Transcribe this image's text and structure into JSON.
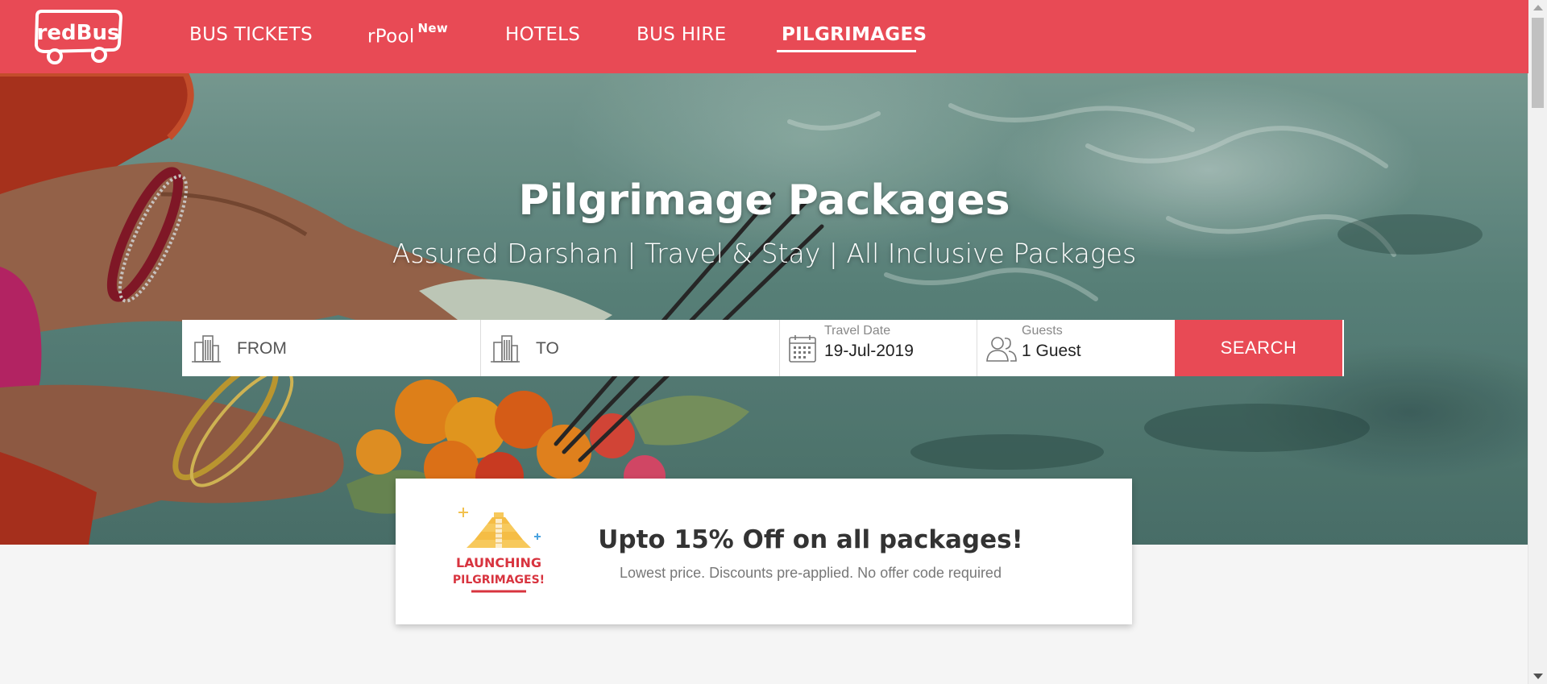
{
  "header": {
    "logo_text": "redBus",
    "nav": [
      {
        "label": "BUS TICKETS",
        "sup": ""
      },
      {
        "label": "rPool",
        "sup": "New"
      },
      {
        "label": "HOTELS",
        "sup": ""
      },
      {
        "label": "BUS HIRE",
        "sup": ""
      },
      {
        "label": "PILGRIMAGES",
        "sup": "",
        "active": true
      }
    ]
  },
  "hero": {
    "title": "Pilgrimage Packages",
    "subtitle": "Assured Darshan | Travel & Stay | All Inclusive Packages"
  },
  "search": {
    "from_placeholder": "FROM",
    "to_placeholder": "TO",
    "date_label": "Travel Date",
    "date_value": "19-Jul-2019",
    "guests_label": "Guests",
    "guests_value": "1 Guest",
    "button_label": "SEARCH"
  },
  "offer": {
    "badge_line1": "LAUNCHING",
    "badge_line2": "PILGRIMAGES!",
    "title": "Upto 15% Off on all packages!",
    "subtitle": "Lowest price. Discounts pre-applied. No offer code required"
  },
  "colors": {
    "brand_red": "#e84a55",
    "badge_gold": "#f7c95c"
  },
  "icons": [
    "redbus-logo",
    "city-icon",
    "calendar-icon",
    "guests-icon",
    "temple-icon"
  ]
}
